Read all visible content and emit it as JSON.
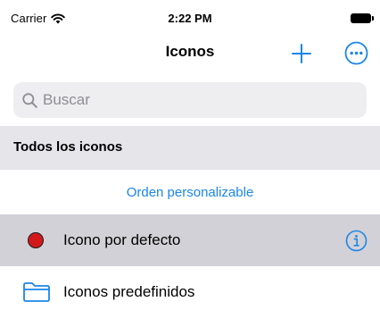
{
  "status_bar": {
    "carrier": "Carrier",
    "time": "2:22 PM"
  },
  "nav": {
    "title": "Iconos",
    "add_icon": "plus-icon",
    "more_icon": "ellipsis-circle-icon"
  },
  "search": {
    "placeholder": "Buscar",
    "value": ""
  },
  "section": {
    "title": "Todos los iconos"
  },
  "sort": {
    "label": "Orden personalizable"
  },
  "list": {
    "items": [
      {
        "label": "Icono por defecto",
        "icon": "red-dot-icon",
        "selected": true,
        "accessory": "info-icon"
      },
      {
        "label": "Iconos predefinidos",
        "icon": "folder-icon",
        "selected": false
      }
    ]
  },
  "colors": {
    "accent": "#1a86e8",
    "selected_row": "#d2d1d7",
    "section_bg": "#e6e5ea",
    "search_bg": "#eeeef0",
    "red_dot": "#d3181c"
  }
}
